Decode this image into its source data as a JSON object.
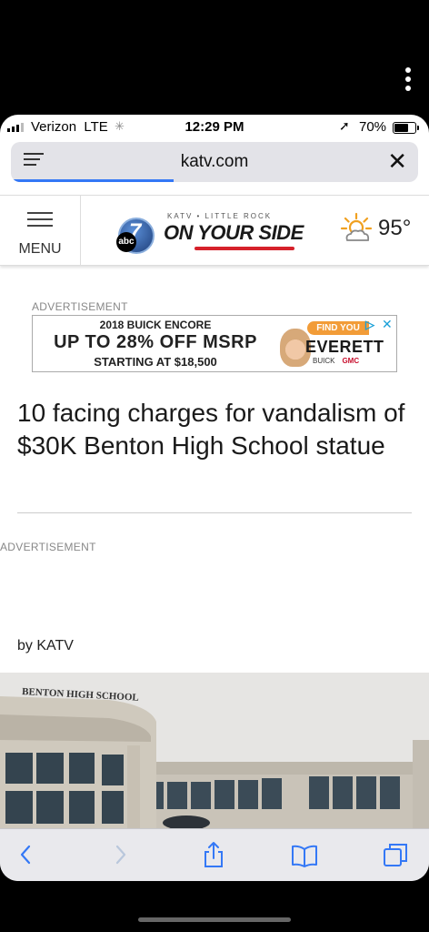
{
  "status_bar": {
    "carrier": "Verizon",
    "network": "LTE",
    "time": "12:29 PM",
    "battery_percent": "70%",
    "battery_level": 0.7
  },
  "browser": {
    "url": "katv.com",
    "load_progress": 0.4
  },
  "site_header": {
    "menu_label": "MENU",
    "logo_tagline": "KATV • LITTLE ROCK",
    "logo_text": "ON YOUR SIDE",
    "logo_number": "7",
    "logo_network": "abc",
    "temperature": "95°"
  },
  "article": {
    "ad_label_top": "ADVERTISEMENT",
    "ad": {
      "line1": "2018 BUICK ENCORE",
      "line2": "UP TO 28% OFF MSRP",
      "line3": "STARTING AT $18,500",
      "cta": "FIND YOU",
      "dealer": "EVERETT",
      "brand1": "BUICK",
      "brand2": "GMC"
    },
    "headline": "10 facing charges for vandalism of $30K Benton High School statue",
    "ad_label_mid": "ADVERTISEMENT",
    "byline": "by KATV",
    "image_sign": "BENTON HIGH SCHOOL"
  },
  "colors": {
    "accent": "#3478f6",
    "ad_orange": "#f29c38",
    "adchoices": "#19a0d8",
    "logo_red": "#d6212b"
  }
}
